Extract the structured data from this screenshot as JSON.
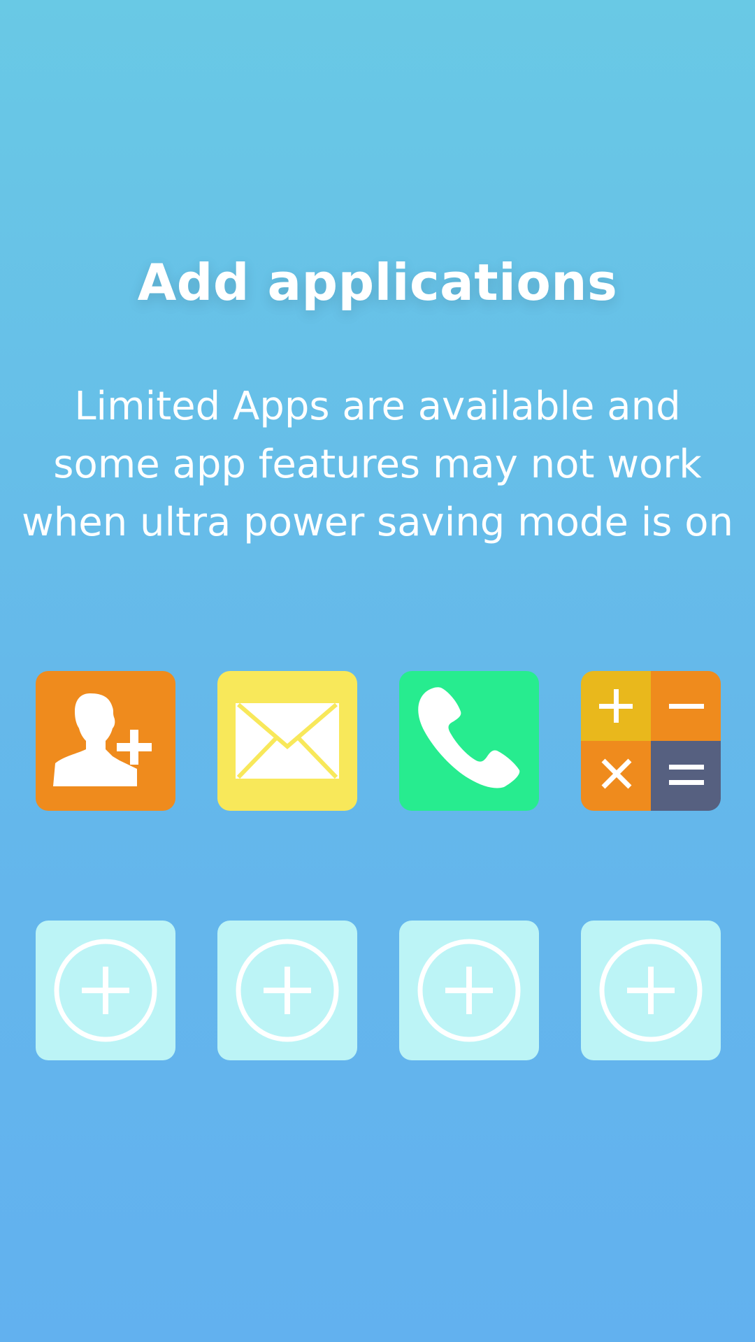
{
  "screen": {
    "title": "Add applications",
    "description_lines": [
      "Limited Apps are available and",
      "some app features may not work",
      "when ultra power saving mode is on"
    ]
  },
  "apps": [
    {
      "name": "add-contact",
      "icon": "add-contact-icon",
      "color": "#ef8b1d"
    },
    {
      "name": "email",
      "icon": "envelope-icon",
      "color": "#f8e85a"
    },
    {
      "name": "phone",
      "icon": "phone-icon",
      "color": "#27ec8f"
    },
    {
      "name": "calculator",
      "icon": "calculator-icon",
      "colors": [
        "#e9b81c",
        "#ef8b1d",
        "#ef8b1d",
        "#566080"
      ]
    }
  ],
  "empty_slots": [
    {
      "icon": "add-circle-icon"
    },
    {
      "icon": "add-circle-icon"
    },
    {
      "icon": "add-circle-icon"
    },
    {
      "icon": "add-circle-icon"
    }
  ],
  "colors": {
    "background_top": "#69c9e5",
    "background_bottom": "#62b1ef",
    "slot_fill": "#bcf4f6",
    "text": "#ffffff"
  }
}
